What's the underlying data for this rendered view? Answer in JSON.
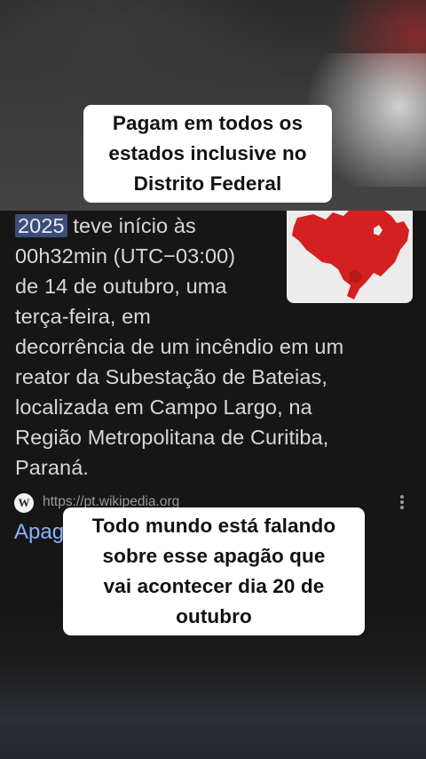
{
  "captions": {
    "top_lines": [
      "Pagam em todos os",
      "estados inclusive no",
      "Distrito Federal"
    ],
    "bottom_lines": [
      "Todo mundo está falando",
      "sobre esse apagão que",
      "vai acontecer dia 20 de",
      "outubro"
    ]
  },
  "article": {
    "year_badge": "2025",
    "lines": [
      " teve início às",
      "00h32min (UTC−03:00)",
      "de 14 de outubro, uma",
      "terça-feira, em",
      "decorrência de um incêndio em um",
      "reator da Subestação de Bateias,",
      "localizada em Campo Largo, na",
      "Região Metropolitana de Curitiba,",
      "Paraná."
    ]
  },
  "source": {
    "icon_letter": "W",
    "url": "https://pt.wikipedia.org",
    "result_title": "Apag"
  },
  "colors": {
    "badge_bg": "#3c4e77",
    "link": "#8ab4f8",
    "map_red": "#d42020"
  },
  "icons": {
    "source": "wikipedia-icon",
    "menu": "kebab-menu-icon",
    "thumbnail": "brazil-map-thumbnail"
  }
}
